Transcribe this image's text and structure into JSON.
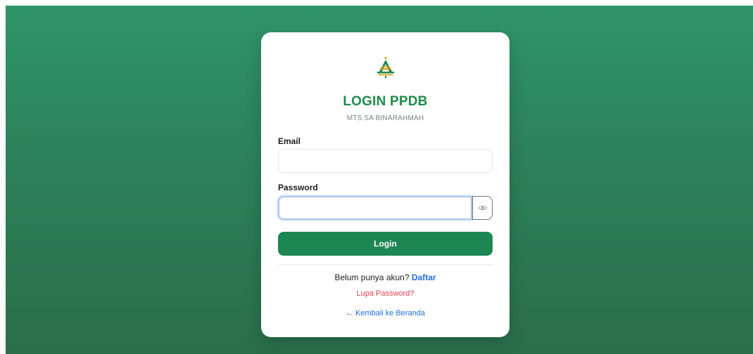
{
  "card": {
    "title": "LOGIN PPDB",
    "subtitle": "MTS SA BINARAHMAH"
  },
  "form": {
    "email_label": "Email",
    "email_value": "",
    "email_placeholder": "",
    "password_label": "Password",
    "password_value": "",
    "password_placeholder": "",
    "toggle_icon": "eye-icon",
    "login_label": "Login"
  },
  "footer": {
    "register_prompt": "Belum punya akun?",
    "register_link": "Daftar",
    "forgot_link": "Lupa Password?",
    "back_link": "← Kembali ke Beranda"
  },
  "colors": {
    "brand_green": "#1d8753",
    "title_green": "#1f8a4c",
    "link_blue": "#1f6fe0",
    "forgot_red": "#d9424f",
    "logo_gold": "#d4a017"
  }
}
